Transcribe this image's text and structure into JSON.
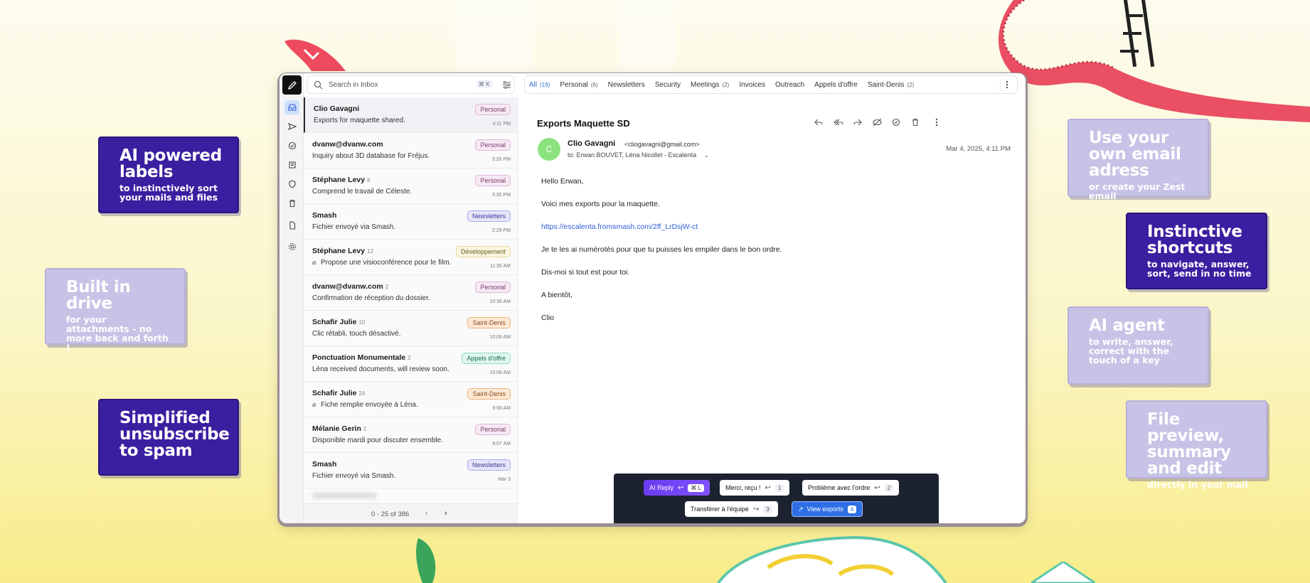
{
  "colors": {
    "accent": "#2f6fd6",
    "card_dark": "#3a1fa0",
    "card_light": "#c8c3e6",
    "ai_bar": "#1d2230"
  },
  "promo": {
    "ai_labels": {
      "title": "AI powered labels",
      "sub": "to instinctively sort your mails and files"
    },
    "drive": {
      "title": "Built in drive",
      "sub": "for your attachments - no more back and forth !"
    },
    "unsubscribe": {
      "title": "Simplified unsubscribe to spam",
      "sub": ""
    },
    "own_email": {
      "title": "Use your own email adress",
      "sub": "or create your Zest email"
    },
    "shortcuts": {
      "title": "Instinctive shortcuts",
      "sub": "to navigate, answer, sort, send in no time"
    },
    "agent": {
      "title": "AI agent",
      "sub": "to write, answer, correct with the touch of a key"
    },
    "file_preview": {
      "title": "File preview, summary and edit",
      "sub": "directly in your mail"
    }
  },
  "search": {
    "placeholder": "Search in Inbox",
    "shortcut": "⌘ K"
  },
  "tabs": [
    {
      "label": "All",
      "count": "(19)"
    },
    {
      "label": "Personal",
      "count": "(6)"
    },
    {
      "label": "Newsletters",
      "count": ""
    },
    {
      "label": "Security",
      "count": ""
    },
    {
      "label": "Meetings",
      "count": "(2)"
    },
    {
      "label": "Invoices",
      "count": ""
    },
    {
      "label": "Outreach",
      "count": ""
    },
    {
      "label": "Appels d'offre",
      "count": ""
    },
    {
      "label": "Saint-Denis",
      "count": "(2)"
    }
  ],
  "emails": [
    {
      "sender": "Clio Gavagni",
      "count": "",
      "subject": "Exports for maquette shared.",
      "time": "4:11 PM",
      "label": "Personal"
    },
    {
      "sender": "dvanw@dvanw.com",
      "count": "",
      "subject": "Inquiry about 3D database for Fréjus.",
      "time": "3:35 PM",
      "label": "Personal"
    },
    {
      "sender": "Stéphane Levy",
      "count": "8",
      "subject": "Comprend le travail de Céleste.",
      "time": "3:35 PM",
      "label": "Personal"
    },
    {
      "sender": "Smash",
      "count": "",
      "subject": "Fichier envoyé via Smash.",
      "time": "2:29 PM",
      "label": "Newsletters"
    },
    {
      "sender": "Stéphane Levy",
      "count": "12",
      "subject": "Propose une visioconférence pour le film.",
      "time": "11:35 AM",
      "label": "Développement"
    },
    {
      "sender": "dvanw@dvanw.com",
      "count": "2",
      "subject": "Confirmation de réception du dossier.",
      "time": "10:36 AM",
      "label": "Personal"
    },
    {
      "sender": "Schafir Julie",
      "count": "10",
      "subject": "Clic rétabli, touch désactivé.",
      "time": "10:09 AM",
      "label": "Saint-Denis"
    },
    {
      "sender": "Ponctuation Monumentale",
      "count": "2",
      "subject": "Léna received documents, will review soon.",
      "time": "10:08 AM",
      "label": "Appels d'offre"
    },
    {
      "sender": "Schafir Julie",
      "count": "24",
      "subject": "Fiche remplie envoyée à Léna.",
      "time": "9:58 AM",
      "label": "Saint-Denis"
    },
    {
      "sender": "Mélanie Gerin",
      "count": "2",
      "subject": "Disponible mardi pour discuter ensemble.",
      "time": "8:07 AM",
      "label": "Personal"
    },
    {
      "sender": "Smash",
      "count": "",
      "subject": "Fichier envoyé via Smash.",
      "time": "Mar 3",
      "label": "Newsletters"
    }
  ],
  "pager": {
    "text": "0 - 25 of 386"
  },
  "mail": {
    "title": "Exports Maquette SD",
    "avatar": "C",
    "from_name": "Clio Gavagni",
    "from_addr": "<cliogavagni@gmail.com>",
    "to": "to: Erwan BOUVET, Léna Nicollet - Escalenta",
    "date": "Mar 4, 2025, 4:11 PM",
    "body": [
      "Hello Erwan,",
      "Voici mes exports pour la maquette.",
      "https://escalenta.fromsmash.com/2ff_LrDsjW-ct",
      "Je te les ai numérotés pour que tu puisses les empiler dans le bon ordre.",
      "Dis-moi si tout est pour toi.",
      "A bientôt,",
      "Clio"
    ]
  },
  "ai_bar": {
    "ai_reply": {
      "label": "AI Reply",
      "key": "⌘ L"
    },
    "merci": {
      "label": "Merci, reçu !",
      "key": "1"
    },
    "probleme": {
      "label": "Problème avec l'ordre",
      "key": "2"
    },
    "transferer": {
      "label": "Transférer à l'équipe",
      "key": "3"
    },
    "view_exports": {
      "label": "View exports",
      "key": "4"
    }
  }
}
